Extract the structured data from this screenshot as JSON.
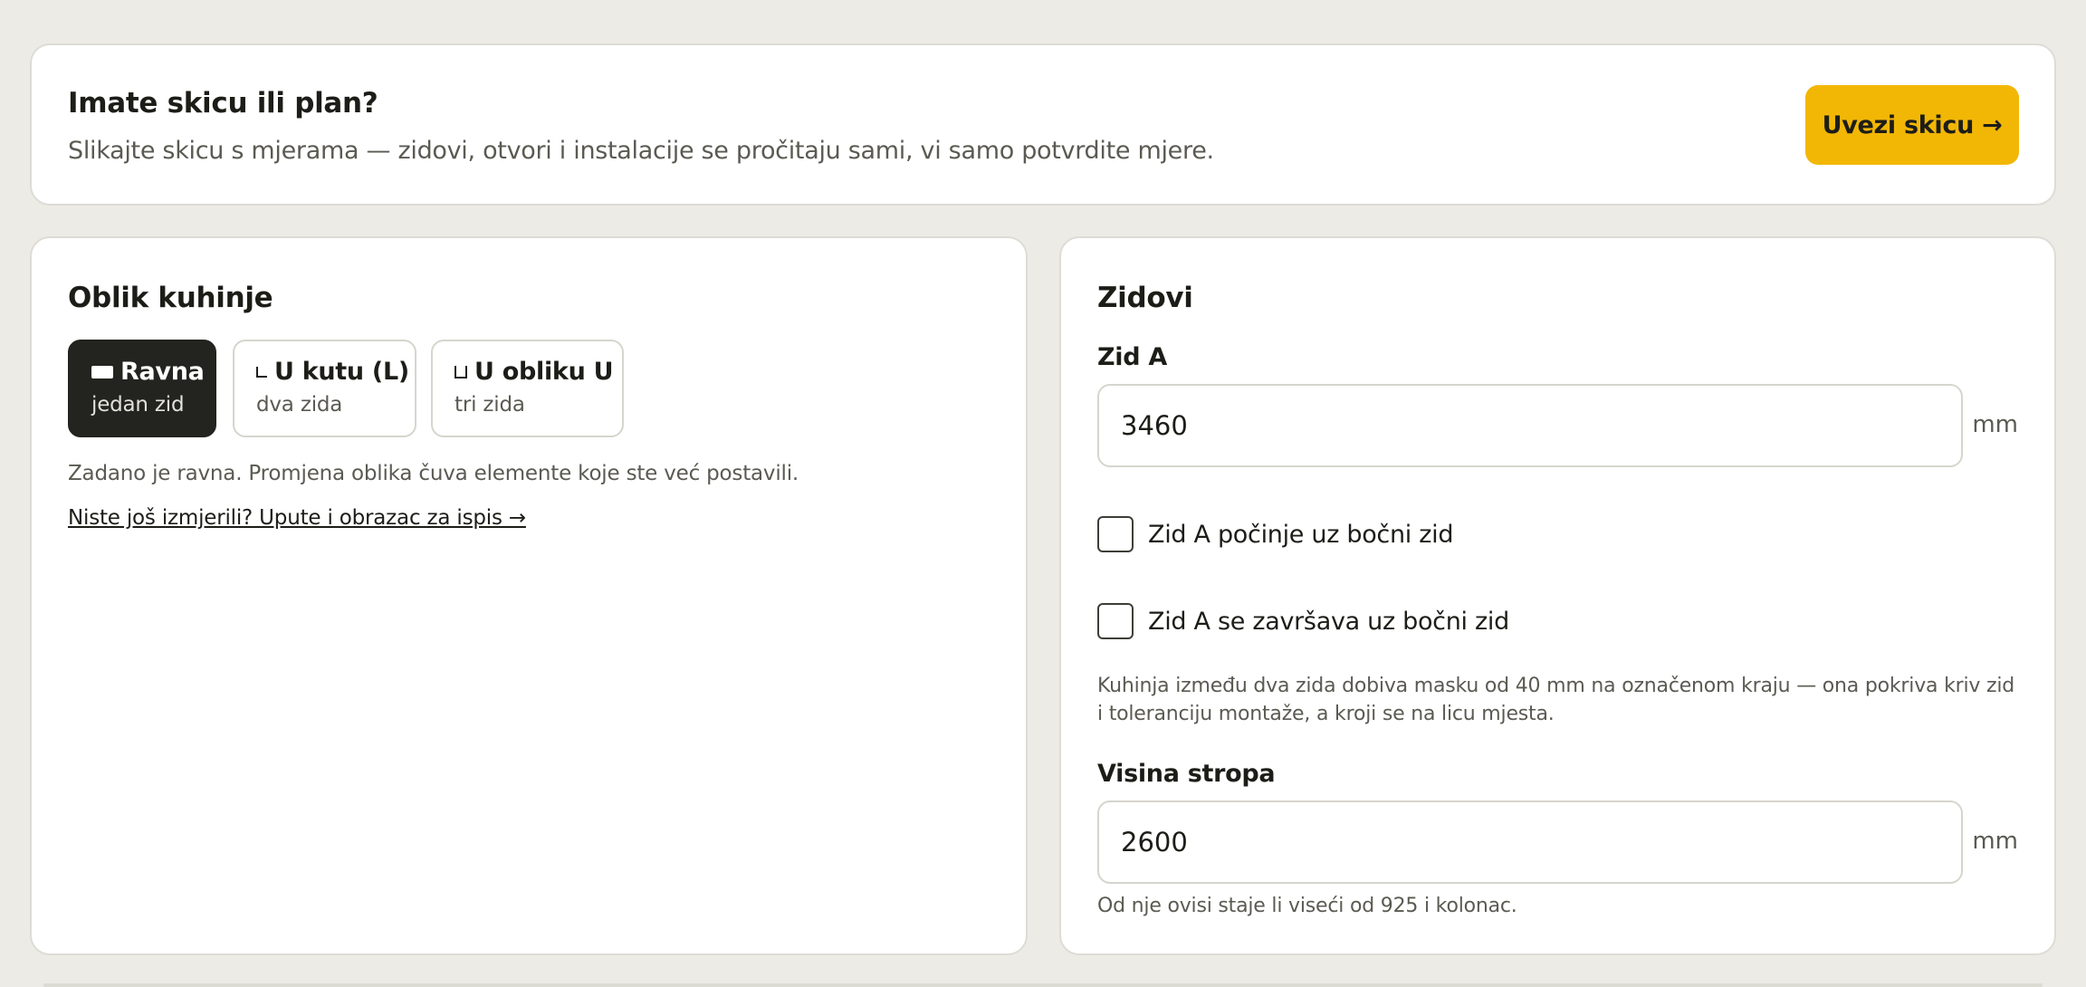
{
  "banner": {
    "title": "Imate skicu ili plan?",
    "subtitle": "Slikajte skicu s mjerama — zidovi, otvori i instalacije se pročitaju sami, vi samo potvrdite mjere.",
    "button_label": "Uvezi skicu →"
  },
  "shape": {
    "heading": "Oblik kuhinje",
    "options": [
      {
        "label": "Ravna",
        "sub": "jedan zid",
        "icon": "flat-wall-icon",
        "selected": true
      },
      {
        "label": "U kutu (L)",
        "sub": "dva zida",
        "icon": "l-shape-icon",
        "selected": false
      },
      {
        "label": "U obliku U",
        "sub": "tri zida",
        "icon": "u-shape-icon",
        "selected": false
      }
    ],
    "note": "Zadano je ravna. Promjena oblika čuva elemente koje ste već postavili.",
    "link": "Niste još izmjerili? Upute i obrazac za ispis →"
  },
  "walls": {
    "heading": "Zidovi",
    "wall_a_label": "Zid A",
    "wall_a_value": "3460",
    "unit": "mm",
    "check_start": {
      "label": "Zid A počinje uz bočni zid",
      "checked": false
    },
    "check_end": {
      "label": "Zid A se završava uz bočni zid",
      "checked": false
    },
    "mask_hint": "Kuhinja između dva zida dobiva masku od 40 mm na označenom kraju — ona pokriva kriv zid i toleranciju montaže, a kroji se na licu mjesta.",
    "ceiling_label": "Visina stropa",
    "ceiling_value": "2600",
    "ceiling_hint": "Od nje ovisi staje li viseći od 925 i kolonac."
  },
  "colors": {
    "accent": "#f2b705",
    "selected_bg": "#23231f",
    "page_bg": "#ecebe6"
  }
}
